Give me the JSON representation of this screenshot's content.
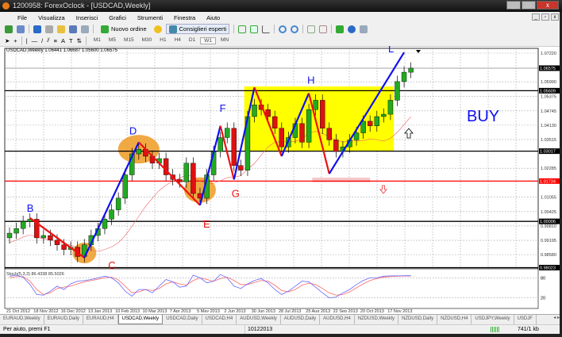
{
  "window": {
    "title": "1200958: ForexOclock - [USDCAD,Weekly]",
    "minimize": "_",
    "maximize": "□",
    "close": "x"
  },
  "menu": [
    "File",
    "Visualizza",
    "Inserisci",
    "Grafici",
    "Strumenti",
    "Finestra",
    "Aiuto"
  ],
  "toolbar": {
    "new_order": "Nuovo ordine",
    "experts": "Consiglieri esperti",
    "timeframes": [
      "M1",
      "M5",
      "M15",
      "M30",
      "H1",
      "H4",
      "D1",
      "W1",
      "MN"
    ],
    "active_timeframe": "W1",
    "text_tool": "A"
  },
  "chart": {
    "info": "USDCAD,Weekly  1.06441 1.06687 1.05600 1.06575",
    "price_labels": [
      "1.07220",
      "1.05990",
      "1.05375",
      "1.04745",
      "1.04130",
      "1.03515",
      "1.02285",
      "1.01055",
      "1.00425",
      "0.99810",
      "0.99195",
      "0.98580"
    ],
    "price_values": [
      1.0722,
      1.0599,
      1.05375,
      1.04745,
      1.0413,
      1.03515,
      1.02285,
      1.01055,
      1.00425,
      0.9981,
      0.99195,
      0.9858
    ],
    "levels": [
      {
        "label": "1.06575",
        "value": 1.06575,
        "color": "#888888",
        "kind": "current"
      },
      {
        "label": "1.05609",
        "value": 1.05609,
        "color": "#000000"
      },
      {
        "label": "1.03017",
        "value": 1.03017,
        "color": "#000000"
      },
      {
        "label": "1.01734",
        "value": 1.01734,
        "color": "#ff0000"
      },
      {
        "label": "1.00006",
        "value": 1.00006,
        "color": "#000000"
      },
      {
        "label": "0.98023",
        "value": 0.98023,
        "color": "#000000"
      }
    ],
    "date_labels": [
      "21 Oct 2012",
      "18 Nov 2012",
      "16 Dec 2012",
      "13 Jan 2013",
      "10 Feb 2013",
      "10 Mar 2013",
      "7 Apr 2013",
      "5 May 2013",
      "2 Jun 2013",
      "30 Jun 2013",
      "28 Jul 2013",
      "25 Aug 2013",
      "22 Sep 2013",
      "20 Oct 2013",
      "17 Nov 2013"
    ],
    "closes": [
      0.995,
      0.997,
      1.0,
      1.001,
      0.993,
      0.994,
      0.992,
      0.99,
      0.988,
      0.989,
      0.985,
      0.99,
      0.994,
      0.997,
      1.001,
      1.005,
      1.01,
      1.02,
      1.029,
      1.031,
      1.028,
      1.025,
      1.027,
      1.02,
      1.018,
      1.017,
      1.025,
      1.012,
      1.01,
      1.02,
      1.03,
      1.036,
      1.04,
      1.024,
      1.022,
      1.045,
      1.05,
      1.048,
      1.045,
      1.04,
      1.032,
      1.036,
      1.042,
      1.034,
      1.048,
      1.052,
      1.04,
      1.035,
      1.03,
      1.032,
      1.035,
      1.038,
      1.043,
      1.041,
      1.045,
      1.046,
      1.052,
      1.06,
      1.064,
      1.06575
    ],
    "zigzag": [
      {
        "label": "B",
        "week": 3,
        "price": 1.0015
      },
      {
        "label": "C",
        "week": 11,
        "price": 0.9845
      },
      {
        "label": "D",
        "week": 19,
        "price": 1.034
      },
      {
        "label": "E",
        "week": 28,
        "price": 1.007
      },
      {
        "label": "F",
        "week": 31,
        "price": 1.041
      },
      {
        "label": "G",
        "week": 33,
        "price": 1.018
      },
      {
        "label": "",
        "week": 36,
        "price": 1.0575
      },
      {
        "label": "",
        "week": 40,
        "price": 1.028
      },
      {
        "label": "H",
        "week": 44,
        "price": 1.055
      },
      {
        "label": "",
        "week": 47,
        "price": 1.0205
      },
      {
        "label": "L",
        "week": 58,
        "price": 1.0725
      }
    ],
    "signal": "BUY",
    "colors": {
      "up": "#22aa22",
      "down": "#dd1111",
      "zig_up": "#1010ee",
      "zig_down": "#ee1111",
      "box": "#ffff00",
      "ellipse": "#f0a030"
    }
  },
  "indicator": {
    "label": "Stoch(5,3,3) 86.4338 85.5026",
    "scale_top": "80",
    "scale_bottom": "20",
    "main": [
      85,
      88,
      82,
      60,
      30,
      28,
      40,
      55,
      45,
      62,
      70,
      72,
      75,
      80,
      85,
      80,
      65,
      40,
      25,
      45,
      45,
      35,
      55,
      75,
      68,
      52,
      55,
      88,
      80,
      65,
      70,
      90,
      80,
      55,
      48,
      62,
      72,
      78,
      65,
      45,
      30,
      40,
      55,
      70,
      68,
      52,
      35,
      20,
      22,
      35,
      45,
      60,
      72,
      80,
      80,
      85,
      86,
      86,
      86.4,
      86.4
    ],
    "signal": [
      80,
      84,
      84,
      70,
      45,
      30,
      35,
      48,
      52,
      55,
      62,
      68,
      72,
      76,
      80,
      82,
      74,
      55,
      35,
      38,
      45,
      42,
      48,
      62,
      68,
      62,
      58,
      72,
      80,
      75,
      70,
      78,
      82,
      72,
      60,
      60,
      66,
      72,
      70,
      58,
      42,
      38,
      45,
      58,
      64,
      60,
      48,
      35,
      28,
      30,
      38,
      50,
      62,
      72,
      78,
      82,
      84,
      85,
      85.5,
      85.5
    ]
  },
  "tabs": [
    "EURAUD,Weekly",
    "EURAUD,Daily",
    "EURAUD,H4",
    "USDCAD,Weekly",
    "USDCAD,Daily",
    "USDCAD,H4",
    "AUDUSD,Weekly",
    "AUDUSD,Daily",
    "AUDUSD,H4",
    "NZDUSD,Weekly",
    "NZDUSD,Daily",
    "NZDUSD,H4",
    "USDJPY,Weekly",
    "USDJF"
  ],
  "active_tab": "USDCAD,Weekly",
  "status": {
    "help": "Per aiuto, premi F1",
    "date": "10122013",
    "traffic": "741/1 kb"
  }
}
